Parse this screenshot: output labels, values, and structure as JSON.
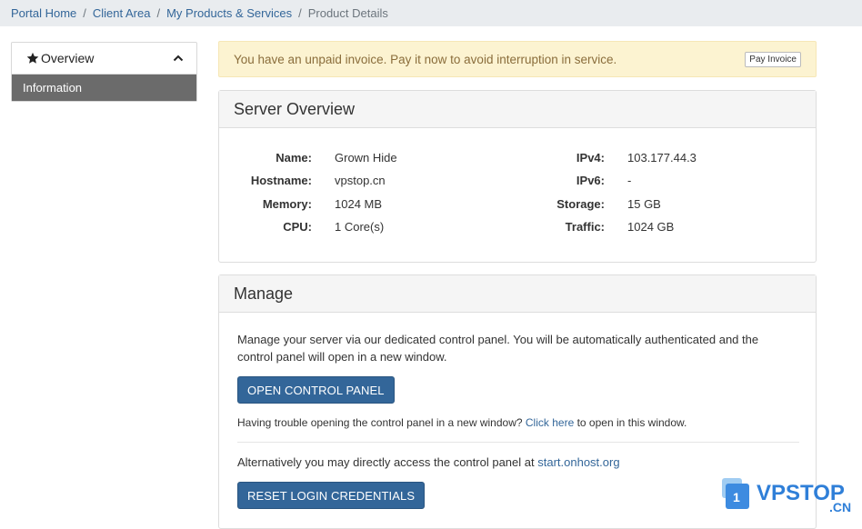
{
  "breadcrumb": {
    "items": [
      "Portal Home",
      "Client Area",
      "My Products & Services"
    ],
    "current": "Product Details",
    "separator": "/"
  },
  "sidebar": {
    "title": "Overview",
    "icon": "star-icon",
    "collapse_icon": "chevron-up-icon",
    "active_item": "Information"
  },
  "alert": {
    "text": "You have an unpaid invoice. Pay it now to avoid interruption in service.",
    "button": "Pay Invoice"
  },
  "server_overview": {
    "title": "Server Overview",
    "left": [
      {
        "label": "Name:",
        "value": "Grown Hide"
      },
      {
        "label": "Hostname:",
        "value": "vpstop.cn"
      },
      {
        "label": "Memory:",
        "value": "1024 MB"
      },
      {
        "label": "CPU:",
        "value": "1 Core(s)"
      }
    ],
    "right": [
      {
        "label": "IPv4:",
        "value": "103.177.44.3"
      },
      {
        "label": "IPv6:",
        "value": "-"
      },
      {
        "label": "Storage:",
        "value": "15 GB"
      },
      {
        "label": "Traffic:",
        "value": "1024 GB"
      }
    ]
  },
  "manage": {
    "title": "Manage",
    "description": "Manage your server via our dedicated control panel. You will be automatically authenticated and the control panel will open in a new window.",
    "open_button": "OPEN CONTROL PANEL",
    "trouble_prefix": "Having trouble opening the control panel in a new window?",
    "trouble_link": "Click here",
    "trouble_suffix": "to open in this window.",
    "alt_prefix": "Alternatively you may directly access the control panel at",
    "alt_link": "start.onhost.org",
    "reset_button": "RESET LOGIN CREDENTIALS"
  },
  "watermark": {
    "badge": "1",
    "text": "VPSTOP",
    "suffix": ".CN"
  },
  "colors": {
    "link": "#336699",
    "button": "#336699",
    "alert_bg": "#fcf3d1",
    "alert_text": "#8a6d3b",
    "sidebar_active": "#6b6b6b",
    "breadcrumb_bg": "#e9ecef"
  }
}
